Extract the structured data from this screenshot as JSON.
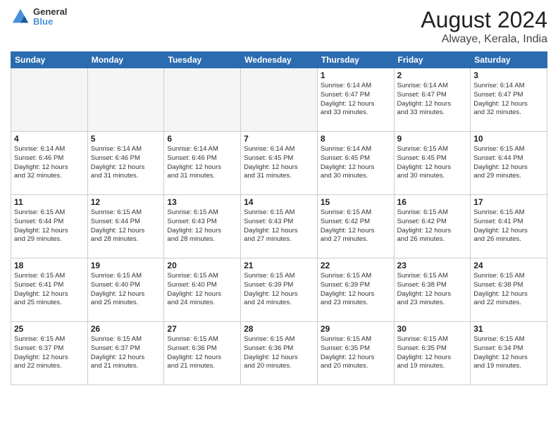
{
  "header": {
    "logo": {
      "line1": "General",
      "line2": "Blue"
    },
    "title": "August 2024",
    "subtitle": "Alwaye, Kerala, India"
  },
  "weekdays": [
    "Sunday",
    "Monday",
    "Tuesday",
    "Wednesday",
    "Thursday",
    "Friday",
    "Saturday"
  ],
  "weeks": [
    [
      {
        "day": "",
        "info": ""
      },
      {
        "day": "",
        "info": ""
      },
      {
        "day": "",
        "info": ""
      },
      {
        "day": "",
        "info": ""
      },
      {
        "day": "1",
        "info": "Sunrise: 6:14 AM\nSunset: 6:47 PM\nDaylight: 12 hours\nand 33 minutes."
      },
      {
        "day": "2",
        "info": "Sunrise: 6:14 AM\nSunset: 6:47 PM\nDaylight: 12 hours\nand 33 minutes."
      },
      {
        "day": "3",
        "info": "Sunrise: 6:14 AM\nSunset: 6:47 PM\nDaylight: 12 hours\nand 32 minutes."
      }
    ],
    [
      {
        "day": "4",
        "info": "Sunrise: 6:14 AM\nSunset: 6:46 PM\nDaylight: 12 hours\nand 32 minutes."
      },
      {
        "day": "5",
        "info": "Sunrise: 6:14 AM\nSunset: 6:46 PM\nDaylight: 12 hours\nand 31 minutes."
      },
      {
        "day": "6",
        "info": "Sunrise: 6:14 AM\nSunset: 6:46 PM\nDaylight: 12 hours\nand 31 minutes."
      },
      {
        "day": "7",
        "info": "Sunrise: 6:14 AM\nSunset: 6:45 PM\nDaylight: 12 hours\nand 31 minutes."
      },
      {
        "day": "8",
        "info": "Sunrise: 6:14 AM\nSunset: 6:45 PM\nDaylight: 12 hours\nand 30 minutes."
      },
      {
        "day": "9",
        "info": "Sunrise: 6:15 AM\nSunset: 6:45 PM\nDaylight: 12 hours\nand 30 minutes."
      },
      {
        "day": "10",
        "info": "Sunrise: 6:15 AM\nSunset: 6:44 PM\nDaylight: 12 hours\nand 29 minutes."
      }
    ],
    [
      {
        "day": "11",
        "info": "Sunrise: 6:15 AM\nSunset: 6:44 PM\nDaylight: 12 hours\nand 29 minutes."
      },
      {
        "day": "12",
        "info": "Sunrise: 6:15 AM\nSunset: 6:44 PM\nDaylight: 12 hours\nand 28 minutes."
      },
      {
        "day": "13",
        "info": "Sunrise: 6:15 AM\nSunset: 6:43 PM\nDaylight: 12 hours\nand 28 minutes."
      },
      {
        "day": "14",
        "info": "Sunrise: 6:15 AM\nSunset: 6:43 PM\nDaylight: 12 hours\nand 27 minutes."
      },
      {
        "day": "15",
        "info": "Sunrise: 6:15 AM\nSunset: 6:42 PM\nDaylight: 12 hours\nand 27 minutes."
      },
      {
        "day": "16",
        "info": "Sunrise: 6:15 AM\nSunset: 6:42 PM\nDaylight: 12 hours\nand 26 minutes."
      },
      {
        "day": "17",
        "info": "Sunrise: 6:15 AM\nSunset: 6:41 PM\nDaylight: 12 hours\nand 26 minutes."
      }
    ],
    [
      {
        "day": "18",
        "info": "Sunrise: 6:15 AM\nSunset: 6:41 PM\nDaylight: 12 hours\nand 25 minutes."
      },
      {
        "day": "19",
        "info": "Sunrise: 6:15 AM\nSunset: 6:40 PM\nDaylight: 12 hours\nand 25 minutes."
      },
      {
        "day": "20",
        "info": "Sunrise: 6:15 AM\nSunset: 6:40 PM\nDaylight: 12 hours\nand 24 minutes."
      },
      {
        "day": "21",
        "info": "Sunrise: 6:15 AM\nSunset: 6:39 PM\nDaylight: 12 hours\nand 24 minutes."
      },
      {
        "day": "22",
        "info": "Sunrise: 6:15 AM\nSunset: 6:39 PM\nDaylight: 12 hours\nand 23 minutes."
      },
      {
        "day": "23",
        "info": "Sunrise: 6:15 AM\nSunset: 6:38 PM\nDaylight: 12 hours\nand 23 minutes."
      },
      {
        "day": "24",
        "info": "Sunrise: 6:15 AM\nSunset: 6:38 PM\nDaylight: 12 hours\nand 22 minutes."
      }
    ],
    [
      {
        "day": "25",
        "info": "Sunrise: 6:15 AM\nSunset: 6:37 PM\nDaylight: 12 hours\nand 22 minutes."
      },
      {
        "day": "26",
        "info": "Sunrise: 6:15 AM\nSunset: 6:37 PM\nDaylight: 12 hours\nand 21 minutes."
      },
      {
        "day": "27",
        "info": "Sunrise: 6:15 AM\nSunset: 6:36 PM\nDaylight: 12 hours\nand 21 minutes."
      },
      {
        "day": "28",
        "info": "Sunrise: 6:15 AM\nSunset: 6:36 PM\nDaylight: 12 hours\nand 20 minutes."
      },
      {
        "day": "29",
        "info": "Sunrise: 6:15 AM\nSunset: 6:35 PM\nDaylight: 12 hours\nand 20 minutes."
      },
      {
        "day": "30",
        "info": "Sunrise: 6:15 AM\nSunset: 6:35 PM\nDaylight: 12 hours\nand 19 minutes."
      },
      {
        "day": "31",
        "info": "Sunrise: 6:15 AM\nSunset: 6:34 PM\nDaylight: 12 hours\nand 19 minutes."
      }
    ]
  ]
}
